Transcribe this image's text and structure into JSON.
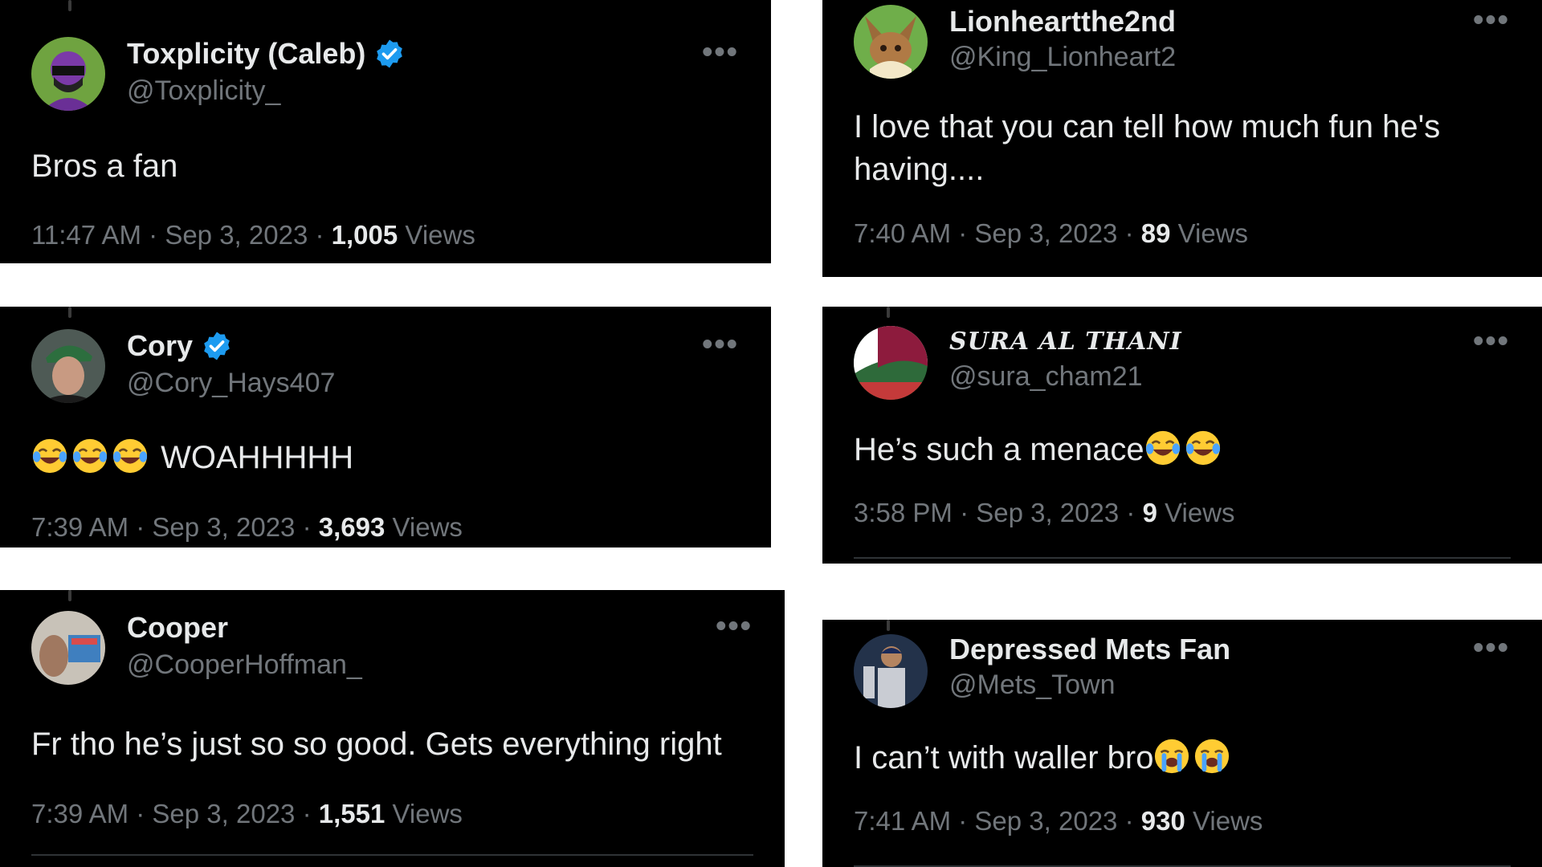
{
  "colors": {
    "background": "#000000",
    "text": "#e7e9ea",
    "muted": "#71767b",
    "verified": "#1d9bf0"
  },
  "icons": {
    "verified": "verified-badge-icon",
    "more": "more-icon",
    "laugh_emoji": "face-with-tears-of-joy-icon",
    "cry_emoji": "loudly-crying-face-icon"
  },
  "tweets": [
    {
      "name": "Toxplicity (Caleb)",
      "handle": "@Toxplicity_",
      "verified": true,
      "text": "Bros a fan",
      "time": "11:47 AM",
      "date": "Sep 3, 2023",
      "views": "1,005",
      "views_label": "Views",
      "more": "•••"
    },
    {
      "name": "Cory",
      "handle": "@Cory_Hays407",
      "verified": true,
      "text": "WOAHHHHH",
      "time": "7:39 AM",
      "date": "Sep 3, 2023",
      "views": "3,693",
      "views_label": "Views",
      "more": "•••"
    },
    {
      "name": "Cooper",
      "handle": "@CooperHoffman_",
      "verified": false,
      "text": "Fr tho he’s just so so good. Gets everything right",
      "time": "7:39 AM",
      "date": "Sep 3, 2023",
      "views": "1,551",
      "views_label": "Views",
      "more": "•••"
    },
    {
      "name": "Lionheartthe2nd",
      "handle": "@King_Lionheart2",
      "verified": false,
      "text_line1": "I love that you can tell how much fun he's",
      "text_line2": "having....",
      "time": "7:40 AM",
      "date": "Sep 3, 2023",
      "views": "89",
      "views_label": "Views",
      "more": "•••"
    },
    {
      "name": "SURA AL THANI",
      "handle": "@sura_cham21",
      "verified": false,
      "text": "He’s such a menace",
      "time": "3:58 PM",
      "date": "Sep 3, 2023",
      "views": "9",
      "views_label": "Views",
      "more": "•••"
    },
    {
      "name": "Depressed Mets Fan",
      "handle": "@Mets_Town",
      "verified": false,
      "text": "I can’t with waller bro",
      "time": "7:41 AM",
      "date": "Sep 3, 2023",
      "views": "930",
      "views_label": "Views",
      "more": "•••"
    }
  ]
}
